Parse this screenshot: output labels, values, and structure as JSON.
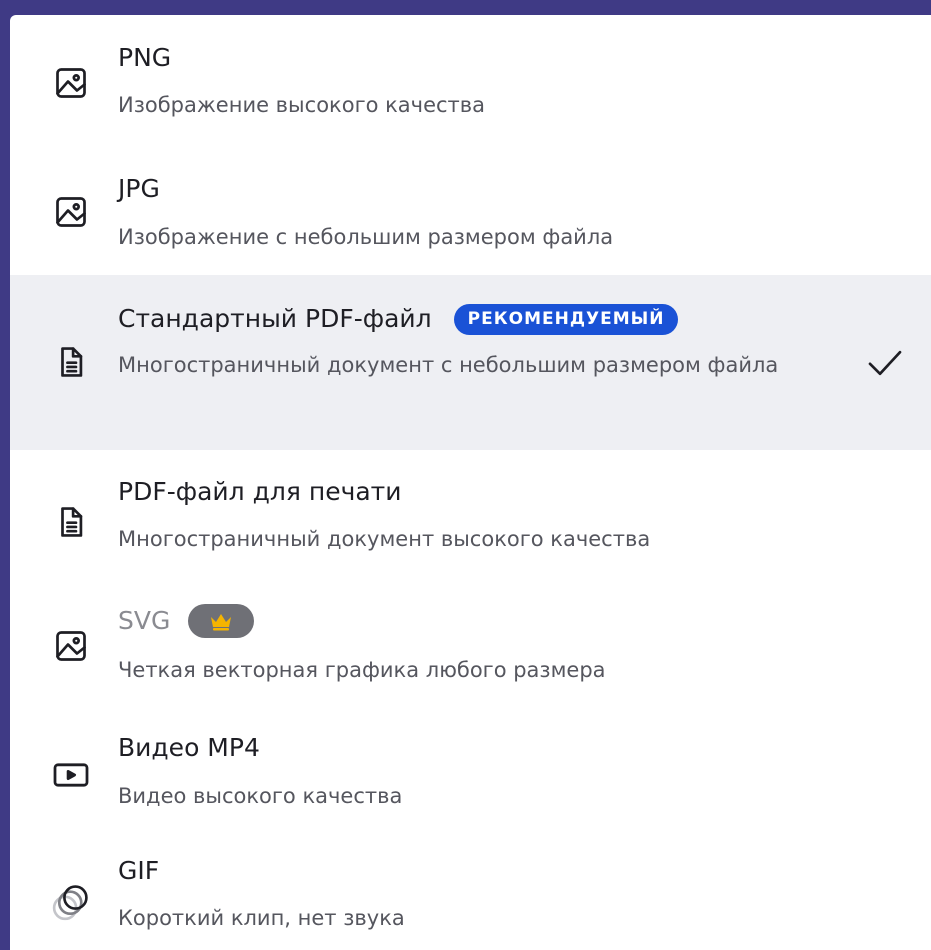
{
  "export_options": [
    {
      "title": "PNG",
      "description": "Изображение высокого качества",
      "icon": "image-icon"
    },
    {
      "title": "JPG",
      "description": "Изображение с небольшим размером файла",
      "icon": "image-icon"
    },
    {
      "title": "Стандартный PDF-файл",
      "badge": "РЕКОМЕНДУЕМЫЙ",
      "description": "Многостраничный документ с небольшим размером файла",
      "icon": "document-icon",
      "selected": true
    },
    {
      "title": "PDF-файл для печати",
      "description": "Многостраничный документ высокого качества",
      "icon": "document-icon"
    },
    {
      "title": "SVG",
      "description": "Четкая векторная графика любого размера",
      "icon": "image-icon",
      "premium": true
    },
    {
      "title": "Видео MP4",
      "description": "Видео высокого качества",
      "icon": "video-play-icon"
    },
    {
      "title": "GIF",
      "description": "Короткий клип, нет звука",
      "icon": "gif-circles-icon"
    }
  ],
  "colors": {
    "background": "#3f3a85",
    "selected_row": "#eeeff3",
    "badge": "#1a52d6",
    "crown": "#f5b400",
    "premium_pill": "#6f7076"
  }
}
